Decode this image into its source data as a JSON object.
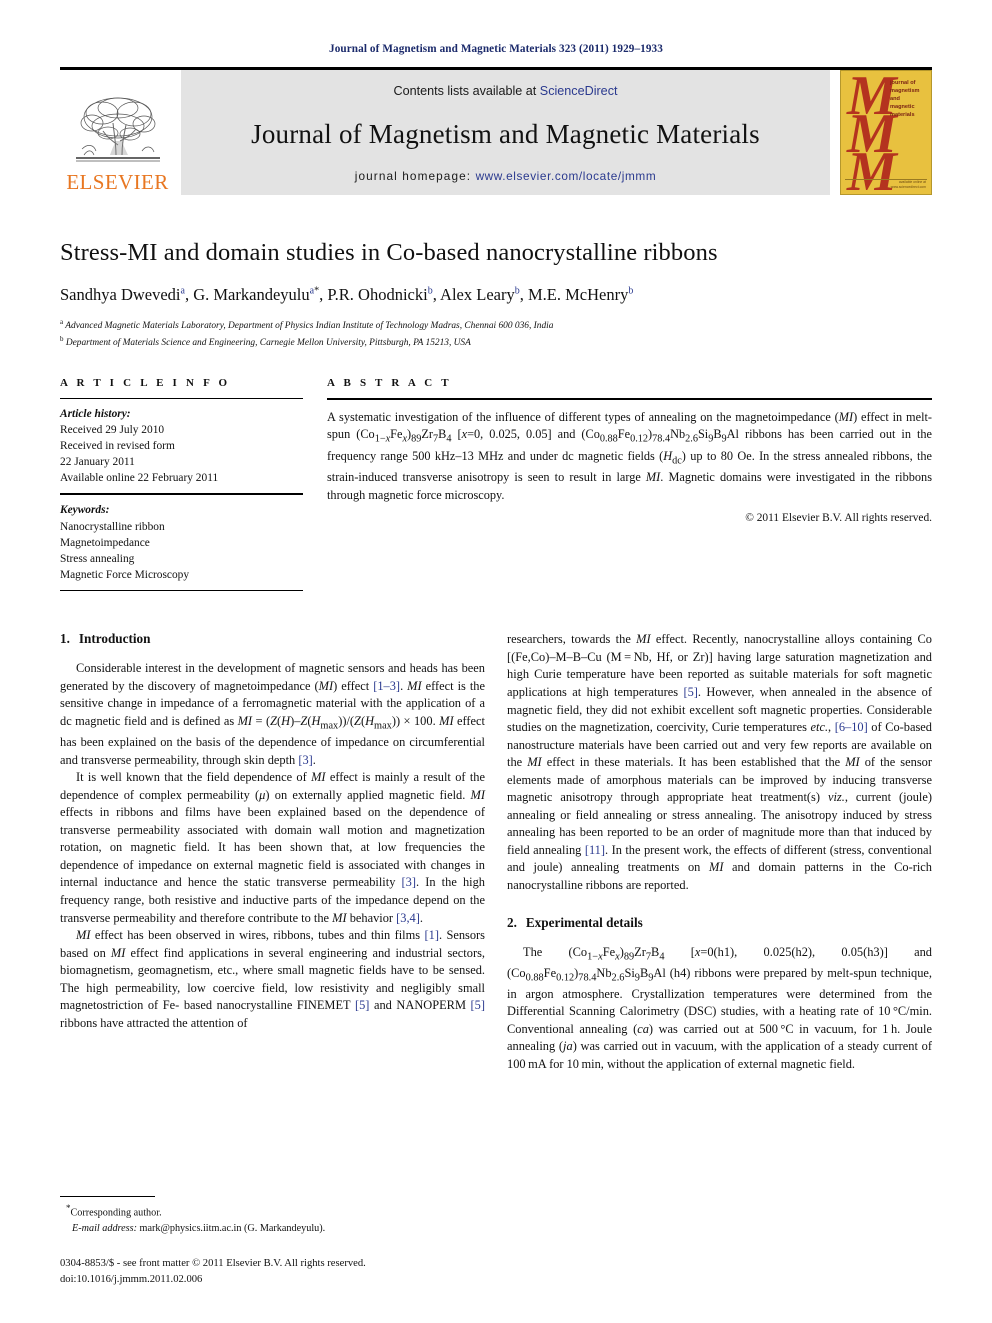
{
  "running_head": "Journal of Magnetism and Magnetic Materials 323 (2011) 1929–1933",
  "masthead": {
    "publisher_wordmark": "ELSEVIER",
    "contents_prefix": "Contents lists available at ",
    "contents_link": "ScienceDirect",
    "journal_title": "Journal of Magnetism and Magnetic Materials",
    "homepage_prefix": "journal homepage: ",
    "homepage_url": "www.elsevier.com/locate/jmmm",
    "cover": {
      "letter": "M",
      "words": [
        "journal of",
        "magnetism",
        "and",
        "magnetic",
        "materials"
      ],
      "footer": "available online at\nwww.sciencedirect.com"
    },
    "colors": {
      "elsevier_orange": "#E87722",
      "link_blue": "#2b3a8f",
      "banner_gray": "#e3e3e3",
      "cover_gold": "#E8C13F",
      "cover_red": "#B4331F"
    }
  },
  "article": {
    "title": "Stress-MI and domain studies in Co-based nanocrystalline ribbons",
    "authors": [
      {
        "name": "Sandhya Dwevedi",
        "marks": "a"
      },
      {
        "name": "G. Markandeyulu",
        "marks": "a",
        "corresponding": "*"
      },
      {
        "name": "P.R. Ohodnicki",
        "marks": "b"
      },
      {
        "name": "Alex Leary",
        "marks": "b"
      },
      {
        "name": "M.E. McHenry",
        "marks": "b"
      }
    ],
    "affiliations": [
      {
        "mark": "a",
        "text": "Advanced Magnetic Materials Laboratory, Department of Physics Indian Institute of Technology Madras, Chennai 600 036, India"
      },
      {
        "mark": "b",
        "text": "Department of Materials Science and Engineering, Carnegie Mellon University, Pittsburgh, PA 15213, USA"
      }
    ]
  },
  "article_info": {
    "heading": "A R T I C L E   I N F O",
    "history_label": "Article history:",
    "history": [
      "Received 29 July 2010",
      "Received in revised form",
      "22 January 2011",
      "Available online 22 February 2011"
    ],
    "keywords_label": "Keywords:",
    "keywords": [
      "Nanocrystalline ribbon",
      "Magnetoimpedance",
      "Stress annealing",
      "Magnetic Force Microscopy"
    ]
  },
  "abstract": {
    "heading": "A B S T R A C T",
    "copyright": "© 2011 Elsevier B.V. All rights reserved."
  },
  "sections": {
    "introduction": {
      "number": "1.",
      "title": "Introduction"
    },
    "experimental": {
      "number": "2.",
      "title": "Experimental details"
    }
  },
  "footnote": {
    "corresponding_marker": "*",
    "corresponding_text": "Corresponding author.",
    "email_label": "E-mail address:",
    "email": "mark@physics.iitm.ac.in (G. Markandeyulu).",
    "issn_line": "0304-8853/$ - see front matter © 2011 Elsevier B.V. All rights reserved.",
    "doi_line": "doi:10.1016/j.jmmm.2011.02.006"
  }
}
